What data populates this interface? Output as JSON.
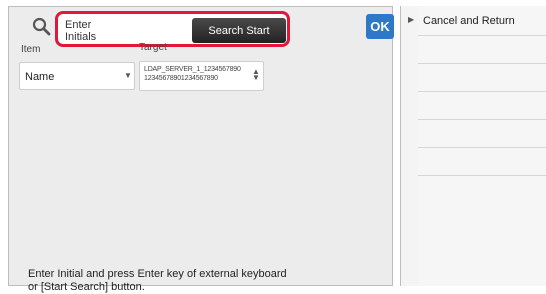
{
  "search": {
    "placeholder": "Enter\nInitials",
    "value": "",
    "start_button_label": "Search Start"
  },
  "ok_label": "OK",
  "columns": {
    "item_header": "Item",
    "target_header": "Target"
  },
  "item_select": {
    "selected": "Name"
  },
  "target_select": {
    "line1": "LDAP_SERVER_1_1234567890",
    "line2": "12345678901234567890"
  },
  "help_text": "Enter Initial and press Enter key of external keyboard or [Start Search] button.",
  "right_menu": {
    "items": [
      {
        "label": "Cancel and Return"
      },
      {
        "label": ""
      },
      {
        "label": ""
      },
      {
        "label": ""
      },
      {
        "label": ""
      },
      {
        "label": ""
      }
    ]
  },
  "icons": {
    "search": "search-icon",
    "collapse": "collapse-arrow-icon",
    "dropdown": "chevron-down-icon",
    "spinner": "up-down-arrows-icon"
  },
  "colors": {
    "highlight_border": "#e2173a",
    "ok_button": "#2d78c7",
    "search_button": "#2a2a2a"
  }
}
